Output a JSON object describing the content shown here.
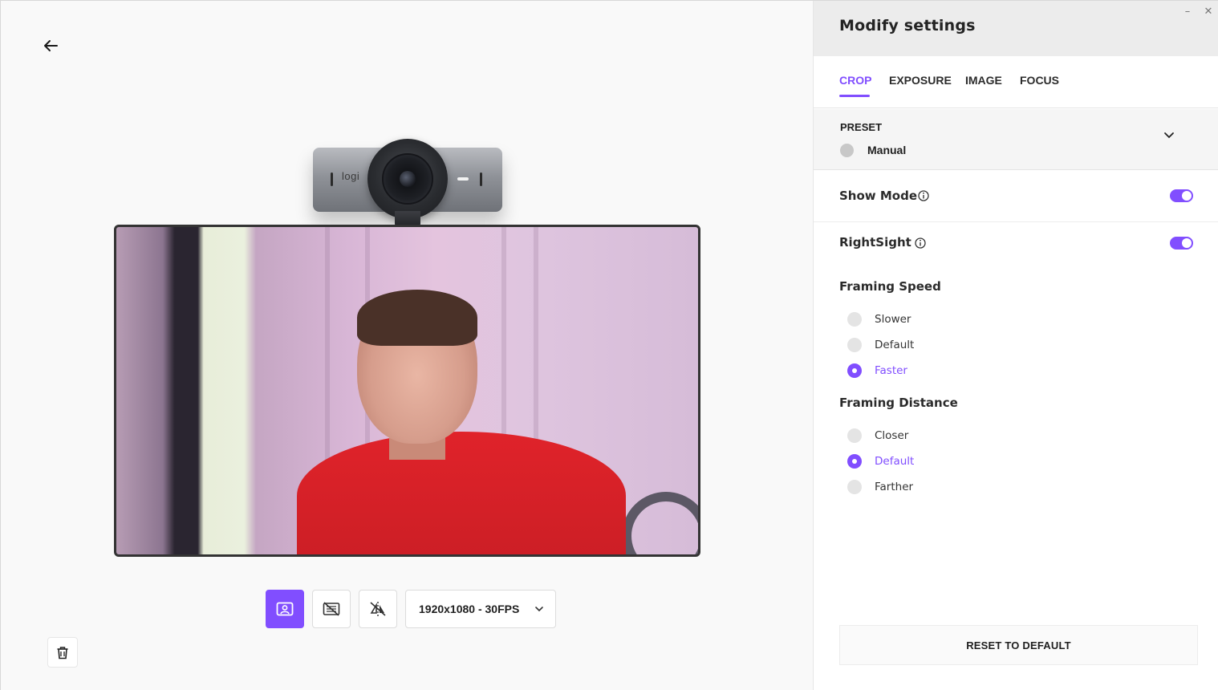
{
  "panel": {
    "title": "Modify settings",
    "window_controls": {
      "minimize": "–",
      "close": "✕"
    }
  },
  "tabs": [
    {
      "label": "CROP",
      "active": true
    },
    {
      "label": "EXPOSURE",
      "active": false
    },
    {
      "label": "IMAGE",
      "active": false
    },
    {
      "label": "FOCUS",
      "active": false
    }
  ],
  "preset": {
    "label": "PRESET",
    "value": "Manual",
    "icon": "chevron-down-icon"
  },
  "show_mode": {
    "label": "Show Mode",
    "enabled": true,
    "icon": "info-icon"
  },
  "rightsight": {
    "label": "RightSight",
    "enabled": true,
    "icon": "info-icon"
  },
  "framing_speed": {
    "title": "Framing Speed",
    "options": [
      {
        "label": "Slower",
        "selected": false
      },
      {
        "label": "Default",
        "selected": false
      },
      {
        "label": "Faster",
        "selected": true
      }
    ]
  },
  "framing_distance": {
    "title": "Framing Distance",
    "options": [
      {
        "label": "Closer",
        "selected": false
      },
      {
        "label": "Default",
        "selected": true
      },
      {
        "label": "Farther",
        "selected": false
      }
    ]
  },
  "reset": {
    "label": "RESET TO DEFAULT"
  },
  "camera": {
    "brand": "logi"
  },
  "toolbar": {
    "resolution": "1920x1080 - 30FPS",
    "buttons": [
      {
        "icon": "portrait-frame-icon",
        "active": true
      },
      {
        "icon": "no-overlay-icon",
        "active": false
      },
      {
        "icon": "mirror-off-icon",
        "active": false
      }
    ]
  },
  "colors": {
    "accent": "#814eff",
    "header_bg": "#ececec",
    "pane_bg": "#f9f9f9"
  }
}
